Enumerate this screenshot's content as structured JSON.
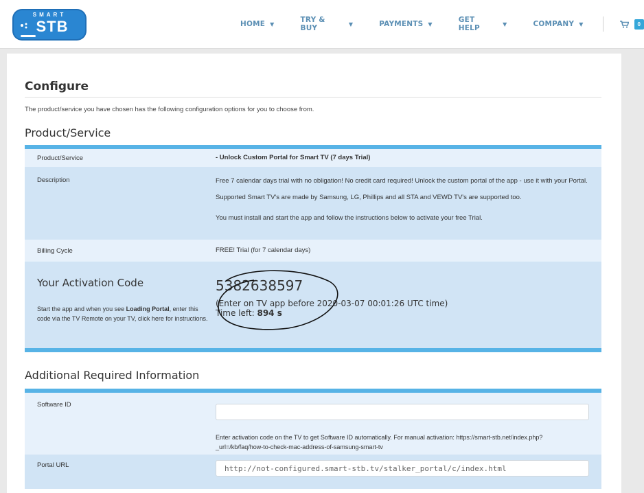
{
  "logo": {
    "top_text": "SMART",
    "main_text": "STB"
  },
  "nav": {
    "items": [
      {
        "label": "HOME"
      },
      {
        "label": "TRY & BUY"
      },
      {
        "label": "PAYMENTS"
      },
      {
        "label": "GET HELP"
      },
      {
        "label": "COMPANY"
      }
    ],
    "cart_count": "0"
  },
  "page": {
    "title": "Configure",
    "intro": "The product/service you have chosen has the following configuration options for you to choose from."
  },
  "product": {
    "section_title": "Product/Service",
    "rows": {
      "product_label": "Product/Service",
      "product_value": "- Unlock Custom Portal for Smart TV (7 days Trial)",
      "description_label": "Description",
      "description_p1": "Free 7 calendar days trial with no obligation! No credit card required! Unlock the custom portal of the app - use it with your Portal.",
      "description_p2": "Supported Smart TV's are made by Samsung, LG, Phillips and all STA and VEWD TV's are supported too.",
      "description_p3": "You must install and start the app and follow the instructions below to activate your free Trial.",
      "billing_label": "Billing Cycle",
      "billing_value": "FREE! Trial (for 7 calendar days)"
    },
    "activation": {
      "title": "Your Activation Code",
      "help_prefix": "Start the app and when you see ",
      "help_bold": "Loading Portal",
      "help_suffix": ", enter this code via the TV Remote on your TV, click here for instructions.",
      "code": "5382638597",
      "note": "(Enter on TV app before 2020-03-07 00:01:26 UTC time)",
      "time_left_label": "Time left: ",
      "time_left_value": "894 s"
    }
  },
  "additional": {
    "section_title": "Additional Required Information",
    "software_id_label": "Software ID",
    "software_id_value": "",
    "software_id_help": "Enter activation code on the TV to get Software ID automatically. For manual activation: https://smart-stb.net/index.php?_url=/kb/faq/how-to-check-mac-address-of-samsung-smart-tv",
    "portal_url_label": "Portal URL",
    "portal_url_value": "http://not-configured.smart-stb.tv/stalker_portal/c/index.html"
  },
  "colors": {
    "accent": "#57b3e6",
    "nav_text": "#5b8fb4",
    "row_light": "#e7f1fb",
    "row_dark": "#d1e4f5"
  }
}
